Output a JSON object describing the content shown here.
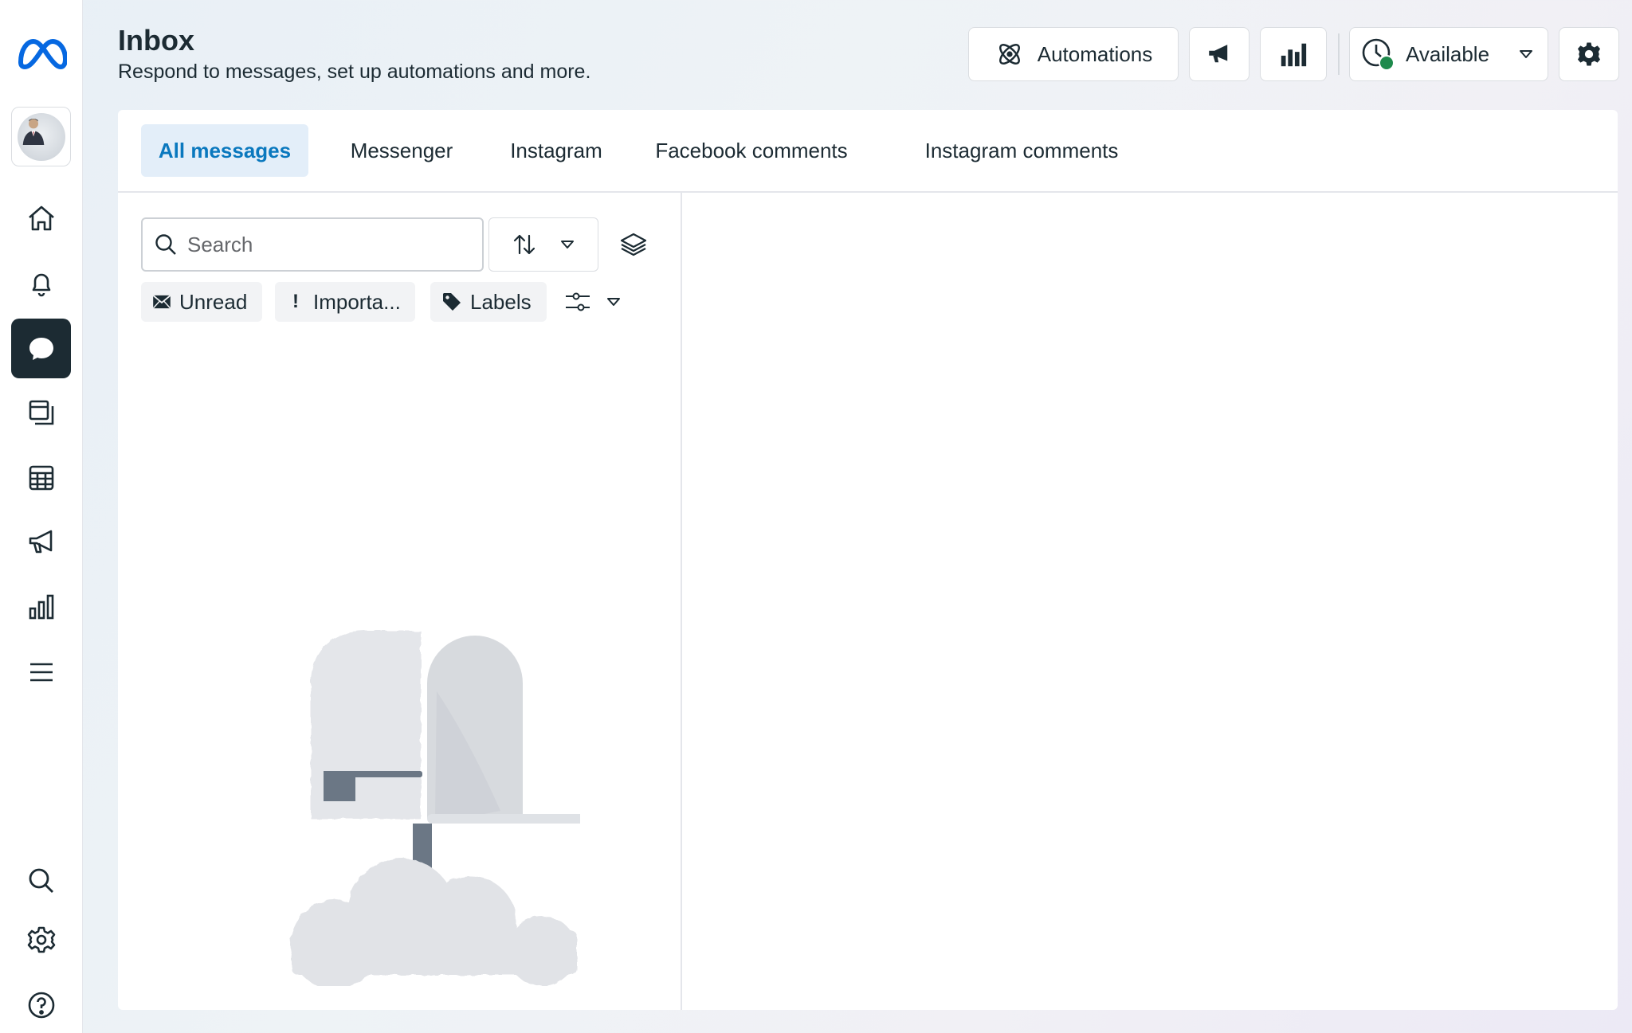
{
  "header": {
    "title": "Inbox",
    "subtitle": "Respond to messages, set up automations and more.",
    "automations_label": "Automations",
    "status_label": "Available"
  },
  "rail": {
    "items": [
      {
        "icon": "meta-logo-icon"
      },
      {
        "icon": "avatar"
      },
      {
        "icon": "home-icon"
      },
      {
        "icon": "bell-icon"
      },
      {
        "icon": "chat-icon",
        "active": true
      },
      {
        "icon": "content-icon"
      },
      {
        "icon": "calendar-grid-icon"
      },
      {
        "icon": "megaphone-icon"
      },
      {
        "icon": "bar-chart-icon"
      },
      {
        "icon": "menu-icon"
      },
      {
        "icon": "search-icon"
      },
      {
        "icon": "gear-icon"
      },
      {
        "icon": "help-icon"
      }
    ]
  },
  "tabs": [
    {
      "label": "All messages",
      "active": true
    },
    {
      "label": "Messenger"
    },
    {
      "label": "Instagram"
    },
    {
      "label": "Facebook comments"
    },
    {
      "label": "Instagram comments"
    }
  ],
  "search": {
    "placeholder": "Search",
    "value": ""
  },
  "chips": {
    "unread": "Unread",
    "important_icon": "!",
    "important": "Importa...",
    "labels": "Labels"
  },
  "colors": {
    "accent": "#0a78be",
    "active_tab_bg": "#e3eef9",
    "rail_active": "#1c2b33",
    "status_online": "#1e8a4c",
    "meta_blue": "#0668e1"
  }
}
